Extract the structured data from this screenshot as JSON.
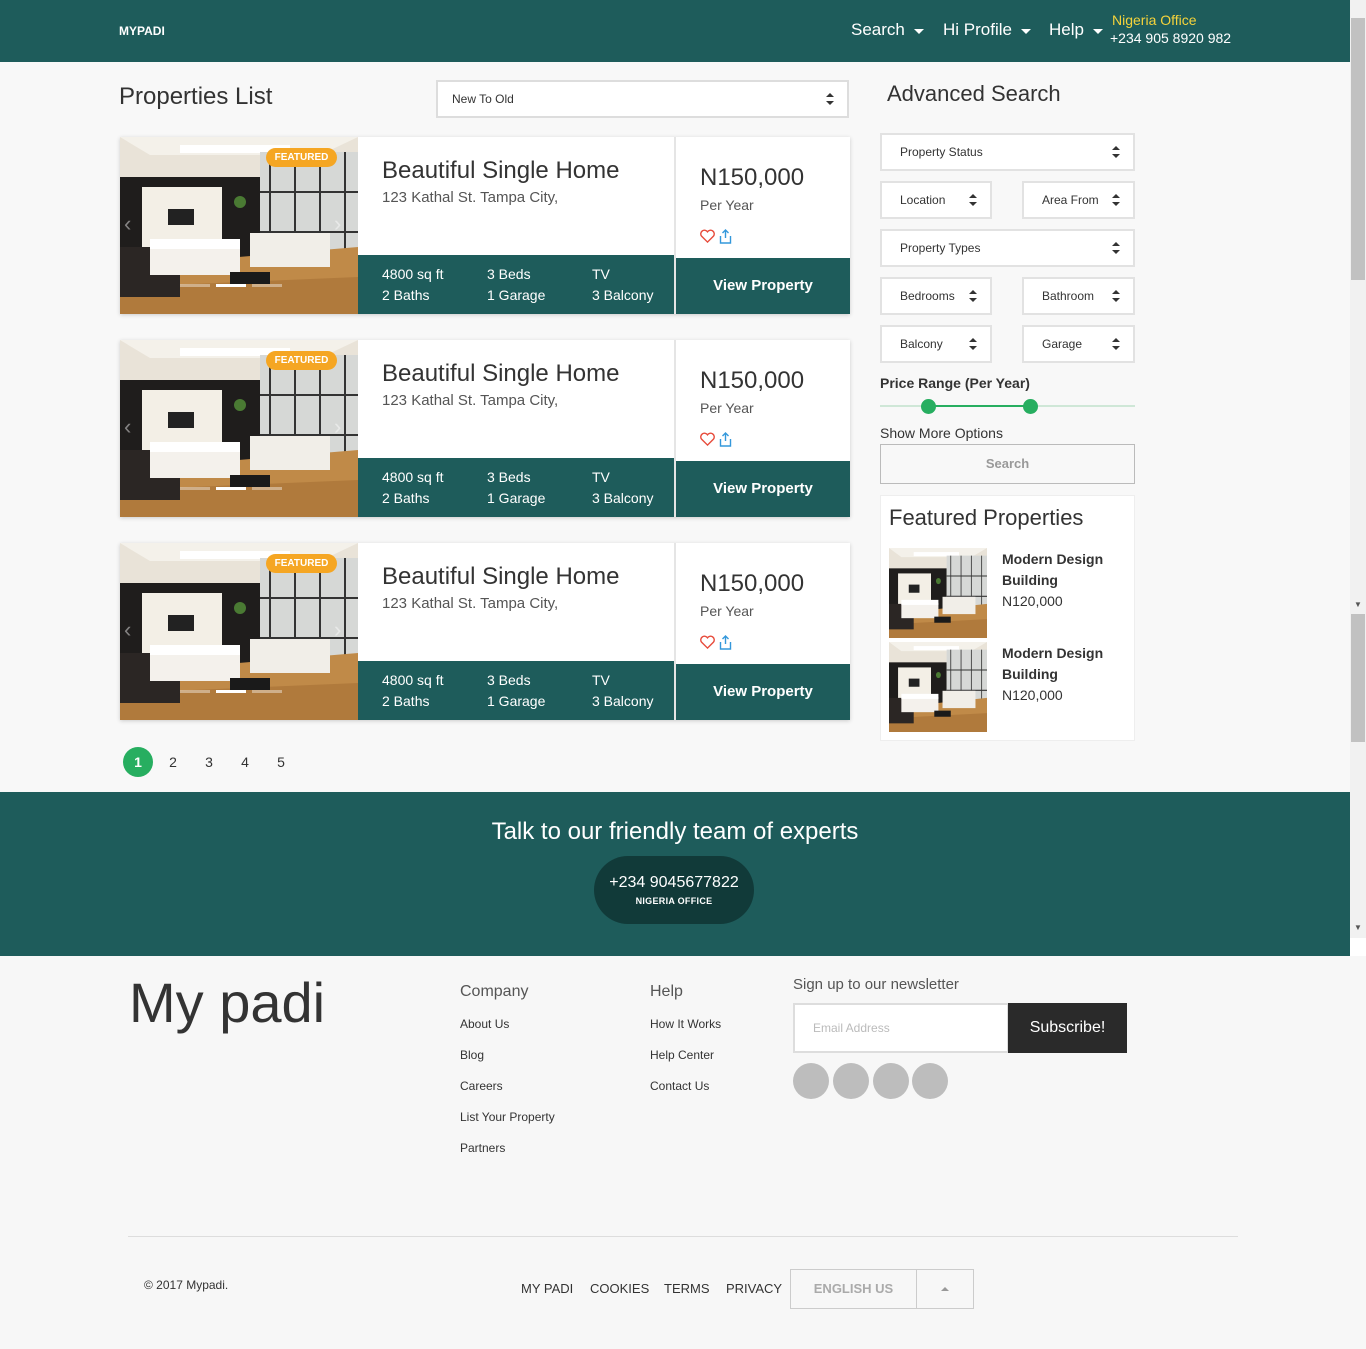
{
  "header": {
    "brand": "MYPADI",
    "nav": [
      {
        "label": "Search"
      },
      {
        "label": "Hi Profile"
      },
      {
        "label": "Help"
      }
    ],
    "office_label": "Nigeria Office",
    "office_phone": "+234 905 8920 982"
  },
  "listing": {
    "title": "Properties List",
    "sort_value": "New To Old",
    "cards": [
      {
        "badge": "FEATURED",
        "title": "Beautiful Single Home",
        "address": "123 Kathal St. Tampa City,",
        "area": "4800 sq ft",
        "baths": "2 Baths",
        "beds": "3 Beds",
        "garage": "1 Garage",
        "tv": "TV",
        "balcony": "3 Balcony",
        "price": "N150,000",
        "period": "Per Year",
        "button": "View Property"
      },
      {
        "badge": "FEATURED",
        "title": "Beautiful Single Home",
        "address": "123 Kathal St. Tampa City,",
        "area": "4800 sq ft",
        "baths": "2 Baths",
        "beds": "3 Beds",
        "garage": "1 Garage",
        "tv": "TV",
        "balcony": "3 Balcony",
        "price": "N150,000",
        "period": "Per Year",
        "button": "View Property"
      },
      {
        "badge": "FEATURED",
        "title": "Beautiful Single Home",
        "address": "123 Kathal St. Tampa City,",
        "area": "4800 sq ft",
        "baths": "2 Baths",
        "beds": "3 Beds",
        "garage": "1 Garage",
        "tv": "TV",
        "balcony": "3 Balcony",
        "price": "N150,000",
        "period": "Per Year",
        "button": "View Property"
      }
    ],
    "pages": [
      "1",
      "2",
      "3",
      "4",
      "5"
    ],
    "current_page": "1"
  },
  "sidebar": {
    "title": "Advanced Search",
    "property_status": "Property Status",
    "location": "Location",
    "area_from": "Area From",
    "property_types": "Property Types",
    "bedrooms": "Bedrooms",
    "bathroom": "Bathroom",
    "balcony": "Balcony",
    "garage": "Garage",
    "price_range_label": "Price Range (Per Year)",
    "price_range": {
      "min_fraction": 0.19,
      "max_fraction": 0.59
    },
    "show_more": "Show More Options",
    "search_button": "Search",
    "featured_title": "Featured Properties",
    "featured": [
      {
        "name": "Modern Design Building",
        "price": "N120,000"
      },
      {
        "name": "Modern Design Building",
        "price": "N120,000"
      }
    ]
  },
  "cta": {
    "title": "Talk to our friendly team of experts",
    "phone": "+234 9045677822",
    "office": "NIGERIA OFFICE"
  },
  "footer": {
    "logo": "My padi",
    "company_title": "Company",
    "company_links": [
      "About Us",
      "Blog",
      "Careers",
      "List Your Property",
      "Partners"
    ],
    "help_title": "Help",
    "help_links": [
      "How It Works",
      "Help Center",
      "Contact Us"
    ],
    "newsletter_title": "Sign up to our newsletter",
    "email_placeholder": "Email Address",
    "subscribe": "Subscribe!",
    "copyright": "© 2017 Mypadi.",
    "bottom_links": [
      "MY PADI",
      "COOKIES",
      "TERMS",
      "PRIVACY"
    ],
    "language": "ENGLISH US"
  },
  "colors": {
    "primary": "#1e5c5b",
    "accent": "#27ae60",
    "badge": "#f5a623",
    "office": "#f5d33b"
  }
}
